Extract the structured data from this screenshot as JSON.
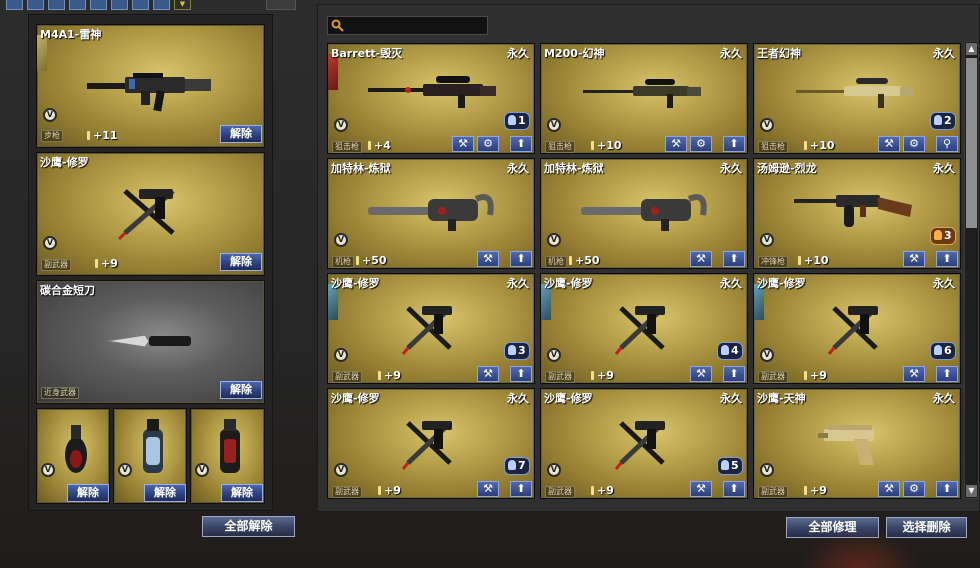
{
  "left": {
    "equipped": [
      {
        "name": "M4A1-雷神",
        "type": "步枪",
        "level": "+11",
        "button": "解除"
      },
      {
        "name": "沙鹰-修罗",
        "type": "副武器",
        "level": "+9",
        "button": "解除"
      },
      {
        "name": "碳合金短刀",
        "type": "近身武器",
        "level": "",
        "button": "解除"
      }
    ],
    "grenades": [
      {
        "button": "解除"
      },
      {
        "button": "解除"
      },
      {
        "button": "解除"
      }
    ],
    "unequip_all": "全部解除"
  },
  "inventory": {
    "search_placeholder": "",
    "items": [
      {
        "name": "Barrett-毁灭",
        "duration": "永久",
        "type": "狙击枪",
        "level": "+4",
        "count": "1"
      },
      {
        "name": "M200-幻神",
        "duration": "永久",
        "type": "狙击枪",
        "level": "+10",
        "count": ""
      },
      {
        "name": "王者幻神",
        "duration": "永久",
        "type": "狙击枪",
        "level": "+10",
        "count": "2"
      },
      {
        "name": "加特林-炼狱",
        "duration": "永久",
        "type": "机枪",
        "level": "+50",
        "count": ""
      },
      {
        "name": "加特林-炼狱",
        "duration": "永久",
        "type": "机枪",
        "level": "+50",
        "count": ""
      },
      {
        "name": "汤姆逊-烈龙",
        "duration": "永久",
        "type": "冲锋枪",
        "level": "+10",
        "count": "3"
      },
      {
        "name": "沙鹰-修罗",
        "duration": "永久",
        "type": "副武器",
        "level": "+9",
        "count": "3"
      },
      {
        "name": "沙鹰-修罗",
        "duration": "永久",
        "type": "副武器",
        "level": "+9",
        "count": "4"
      },
      {
        "name": "沙鹰-修罗",
        "duration": "永久",
        "type": "副武器",
        "level": "+9",
        "count": "6"
      },
      {
        "name": "沙鹰-修罗",
        "duration": "永久",
        "type": "副武器",
        "level": "+9",
        "count": "7"
      },
      {
        "name": "沙鹰-修罗",
        "duration": "永久",
        "type": "副武器",
        "level": "+9",
        "count": "5"
      },
      {
        "name": "沙鹰-天神",
        "duration": "永久",
        "type": "副武器",
        "level": "+9",
        "count": ""
      }
    ],
    "repair_all": "全部修理",
    "select_delete": "选择删除"
  },
  "icons": {
    "v_badge": "V",
    "upgrade": "wrench-icon",
    "settings": "gear-icon",
    "equip": "arrow-up-icon",
    "search": "magnifier-icon"
  },
  "colors": {
    "card_gold": "#b5a04a",
    "button_blue": "#2d4280",
    "count_orange": "#e0a050"
  }
}
